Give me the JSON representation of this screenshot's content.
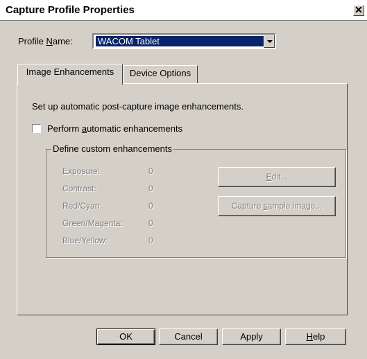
{
  "window": {
    "title": "Capture Profile Properties",
    "close_glyph": "✕"
  },
  "profile": {
    "label_prefix": "Profile ",
    "label_underlined": "N",
    "label_suffix": "ame:",
    "value": "WACOM Tablet"
  },
  "tabs": [
    {
      "label": "Image Enhancements",
      "active": true
    },
    {
      "label": "Device Options",
      "active": false
    }
  ],
  "panel": {
    "description": "Set up automatic post-capture image enhancements.",
    "checkbox": {
      "label_prefix": "Perform ",
      "label_underlined": "a",
      "label_suffix": "utomatic enhancements",
      "checked": false
    },
    "group_title": "Define custom enhancements",
    "enhancements": [
      {
        "label": "Exposure:",
        "value": "0"
      },
      {
        "label": "Contrast:",
        "value": "0"
      },
      {
        "label": "Red/Cyan:",
        "value": "0"
      },
      {
        "label": "Green/Magenta:",
        "value": "0"
      },
      {
        "label": "Blue/Yellow:",
        "value": "0"
      }
    ],
    "edit_button": {
      "underlined": "E",
      "suffix": "dit..."
    },
    "capture_button": {
      "prefix": "Capture ",
      "underlined": "s",
      "suffix": "ample image..."
    }
  },
  "buttons": {
    "ok": "OK",
    "cancel": "Cancel",
    "apply": "Apply",
    "help_underlined": "H",
    "help_suffix": "elp"
  },
  "colors": {
    "face": "#d4d0c8",
    "selection": "#0a246a",
    "disabled_text": "#808080"
  }
}
